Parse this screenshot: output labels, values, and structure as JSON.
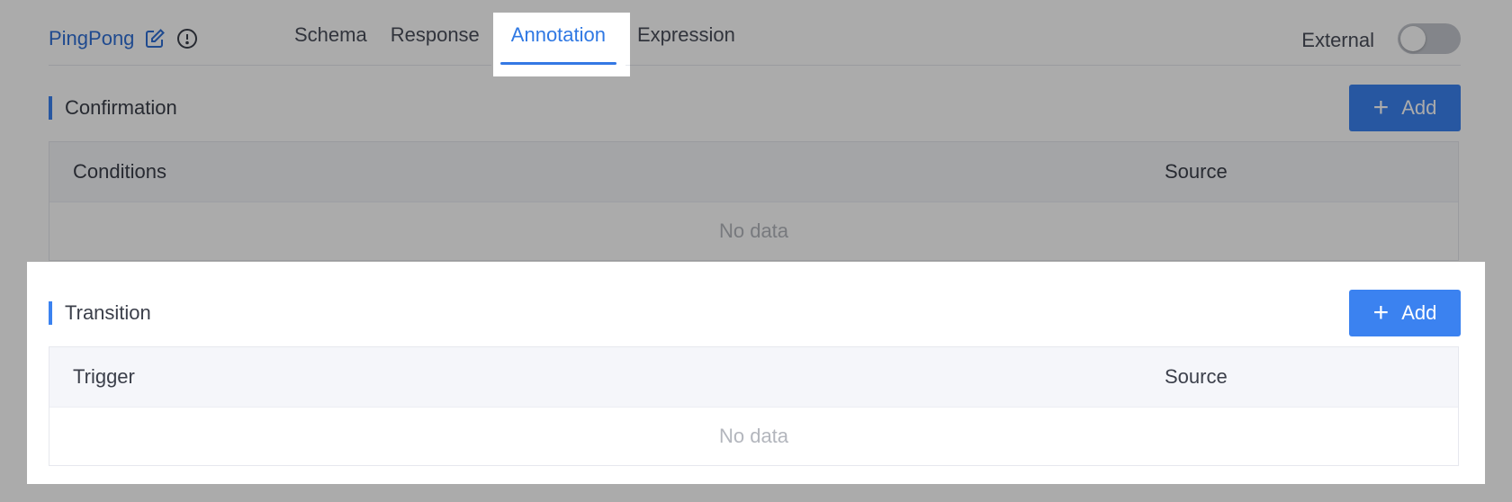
{
  "header": {
    "app_title": "PingPong",
    "tabs": [
      {
        "label": "Schema",
        "active": false
      },
      {
        "label": "Response",
        "active": false
      },
      {
        "label": "Annotation",
        "active": true
      },
      {
        "label": "Expression",
        "active": false
      }
    ],
    "external_label": "External",
    "external_enabled": false
  },
  "sections": [
    {
      "title": "Confirmation",
      "add_label": "Add",
      "columns": [
        "Conditions",
        "Source"
      ],
      "empty_text": "No data"
    },
    {
      "title": "Transition",
      "add_label": "Add",
      "columns": [
        "Trigger",
        "Source"
      ],
      "empty_text": "No data"
    }
  ],
  "colors": {
    "accent": "#3b82f0",
    "title_blue": "#2f6fd6",
    "overlay": "rgba(0,0,0,0.33)"
  },
  "icons": {
    "edit": "edit-icon",
    "info": "info-circle-icon",
    "add": "plus-icon"
  }
}
